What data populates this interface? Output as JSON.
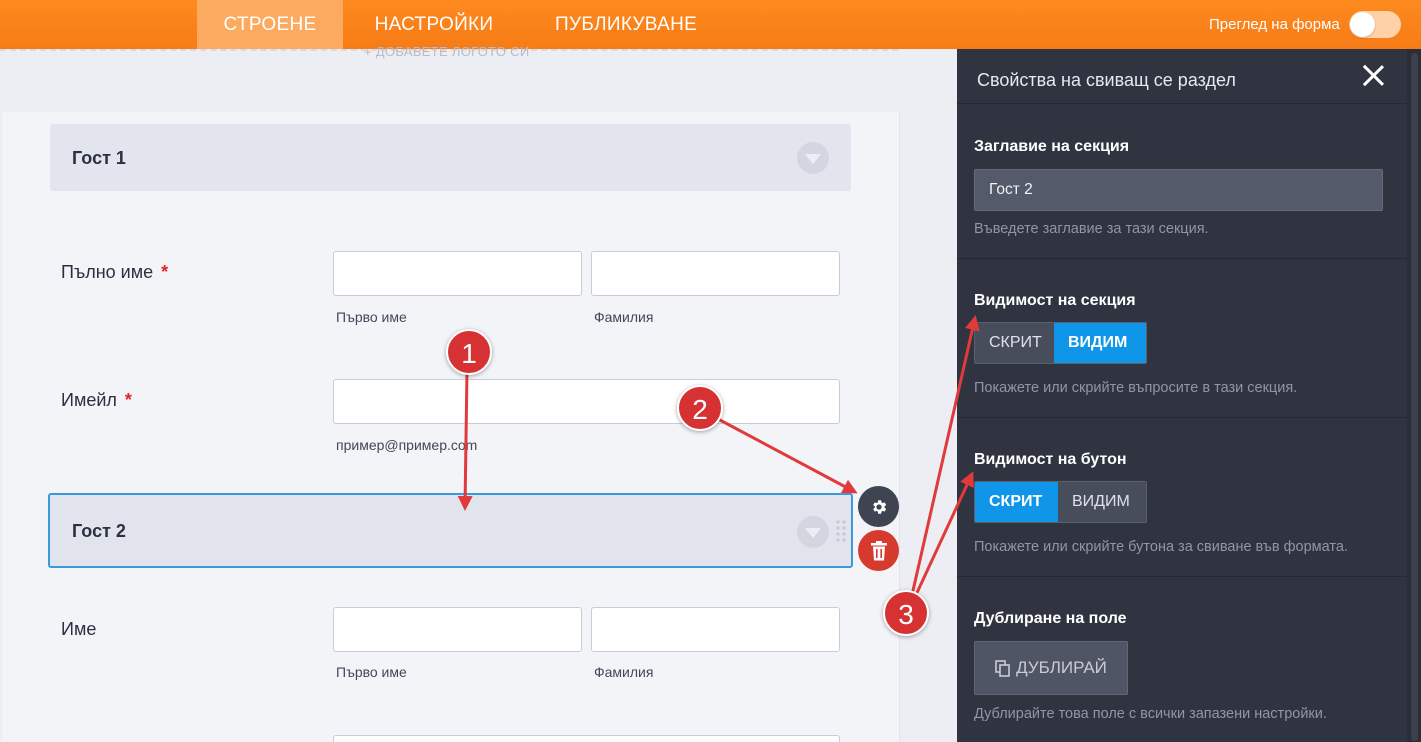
{
  "topbar": {
    "tabs": [
      {
        "label": "СТРОЕНЕ",
        "active": true
      },
      {
        "label": "НАСТРОЙКИ",
        "active": false
      },
      {
        "label": "ПУБЛИКУВАНЕ",
        "active": false
      }
    ],
    "preview_label": "Преглед на форма",
    "preview_toggle": false
  },
  "form": {
    "logo_hint": "+ ДОБАВЕТЕ ЛОГОТО СИ",
    "section1_title": "Гост 1",
    "full_name_label": "Пълно име",
    "required_mark": "*",
    "first_name_sub": "Първо име",
    "last_name_sub": "Фамилия",
    "email_label": "Имейл",
    "email_sub": "пример@пример.com",
    "section2_title": "Гост 2",
    "name_label": "Име",
    "first_name_sub2": "Първо име",
    "last_name_sub2": "Фамилия"
  },
  "panel": {
    "title": "Свойства на свиващ се раздел",
    "section_title_label": "Заглавие на секция",
    "section_title_value": "Гост 2",
    "section_title_help": "Въведете заглавие за тази секция.",
    "visibility_label": "Видимост на секция",
    "visibility_options": {
      "hidden": "СКРИТ",
      "visible": "ВИДИМ"
    },
    "visibility_selected": "ВИДИМ",
    "visibility_help": "Покажете или скрийте въпросите в тази секция.",
    "button_visibility_label": "Видимост на бутон",
    "button_visibility_options": {
      "hidden": "СКРИТ",
      "visible": "ВИДИМ"
    },
    "button_visibility_selected": "СКРИТ",
    "button_visibility_help": "Покажете или скрийте бутона за свиване във формата.",
    "duplicate_label": "Дублиране на поле",
    "duplicate_button": "ДУБЛИРАЙ",
    "duplicate_help": "Дублирайте това поле с всички запазени настройки."
  },
  "annotations": [
    "1",
    "2",
    "3"
  ],
  "colors": {
    "accent": "#fb7f1a",
    "selected": "#0f96e8",
    "annotation": "#d63234",
    "panel_bg": "#2f3440"
  },
  "icons": [
    "gear-icon",
    "trash-icon",
    "close-icon",
    "copy-icon",
    "chevron-down-icon",
    "drag-handle-icon"
  ]
}
